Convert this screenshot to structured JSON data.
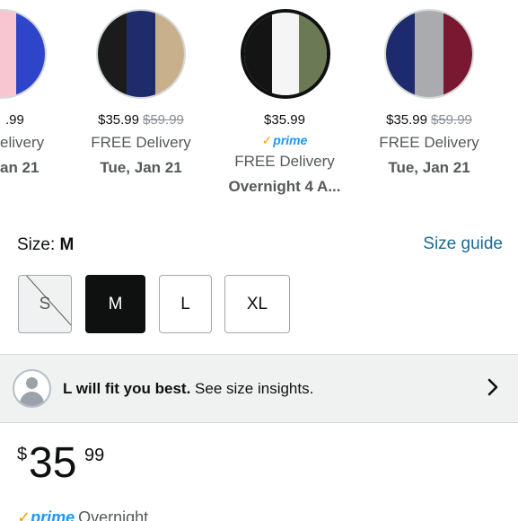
{
  "colors": [
    {
      "name": "pink-blue",
      "stripes": [
        "#f4b9c7",
        "#f7c6d1",
        "#2f45c9"
      ],
      "price": ".99",
      "list_price": "",
      "prime": false,
      "delivery": "elivery",
      "date": "an 21"
    },
    {
      "name": "black-navy-leopard",
      "stripes": [
        "#1b1b1b",
        "#1f2c6b",
        "#c8b08c"
      ],
      "price": "$35.99",
      "list_price": "$59.99",
      "prime": false,
      "delivery": "FREE Delivery",
      "date": "Tue, Jan 21"
    },
    {
      "name": "black-white-olive",
      "stripes": [
        "#141414",
        "#f5f5f5",
        "#6b7a54"
      ],
      "price": "$35.99",
      "list_price": "",
      "prime": true,
      "delivery": "FREE Delivery",
      "date": "Overnight 4 A..."
    },
    {
      "name": "navy-grey-wine",
      "stripes": [
        "#1e2a6e",
        "#a9abae",
        "#7a1832"
      ],
      "price": "$35.99",
      "list_price": "$59.99",
      "prime": false,
      "delivery": "FREE Delivery",
      "date": "Tue, Jan 21"
    }
  ],
  "prime_label": "prime",
  "size": {
    "label": "Size:",
    "selected": "M",
    "guide_link": "Size guide",
    "options": [
      {
        "label": "S",
        "state": "unavailable"
      },
      {
        "label": "M",
        "state": "selected"
      },
      {
        "label": "L",
        "state": "available"
      },
      {
        "label": "XL",
        "state": "available"
      }
    ]
  },
  "fit": {
    "bold": "L will fit you best.",
    "rest": " See size insights."
  },
  "price": {
    "symbol": "$",
    "whole": "35",
    "fraction": "99"
  },
  "shipping": {
    "prime_word": "prime",
    "speed": "Overnight"
  },
  "accent": {
    "prime_blue": "#1a98ff",
    "prime_check": "#ff9900",
    "link": "#1b6b93"
  }
}
